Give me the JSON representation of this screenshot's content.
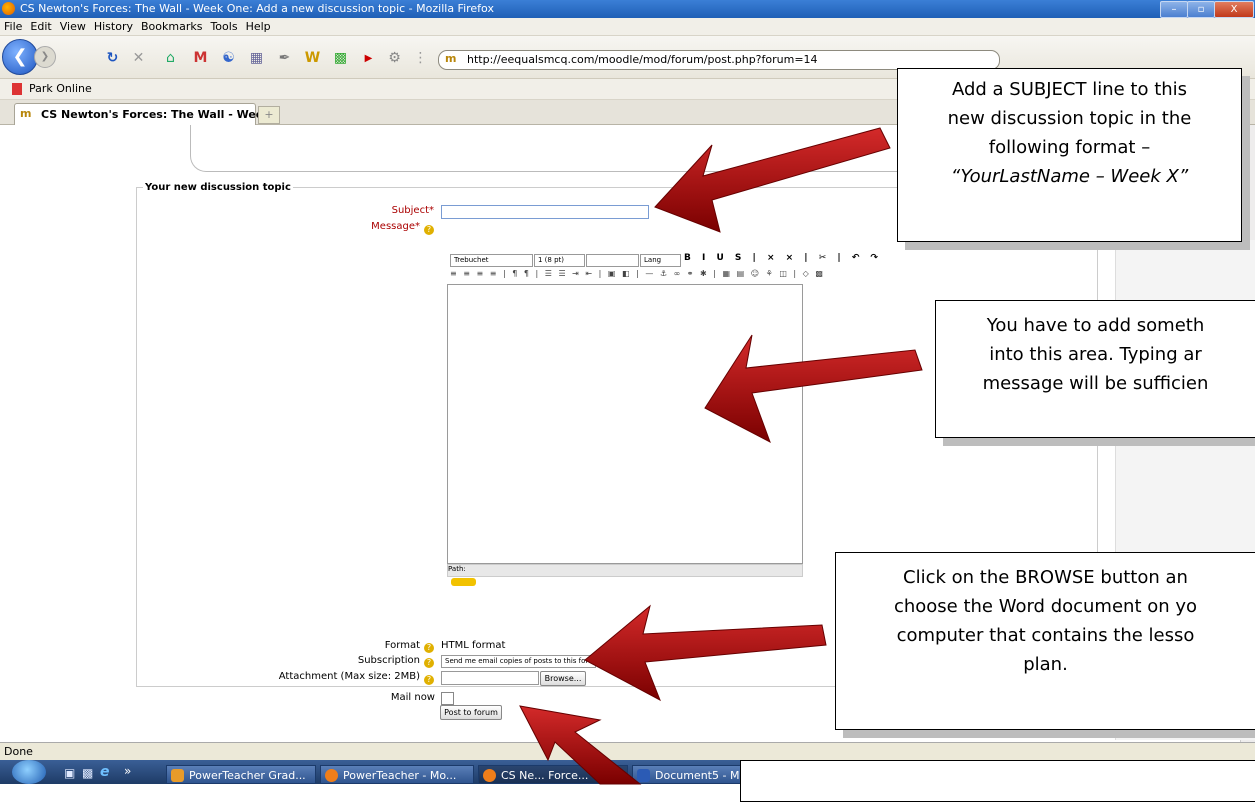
{
  "window": {
    "title": "CS Newton's Forces: The Wall - Week One: Add a new discussion topic - Mozilla Firefox",
    "buttons": [
      "–",
      "▫",
      "X"
    ]
  },
  "menu": [
    "File",
    "Edit",
    "View",
    "History",
    "Bookmarks",
    "Tools",
    "Help"
  ],
  "nav": {
    "url": "http://eequalsmcq.com/moodle/mod/forum/post.php?forum=14",
    "favicon": "m"
  },
  "bookmarks": {
    "item": "Park Online"
  },
  "tabs": [
    {
      "label": "CS Newton's Forces: The Wall - Wee..."
    }
  ],
  "form": {
    "legend": "Your new discussion topic",
    "subject_label": "Subject*",
    "message_label": "Message*",
    "editor": {
      "font": "Trebuchet",
      "size": "1 (8 pt)",
      "lang": "Lang",
      "path": "Path:"
    },
    "format_label": "Format",
    "format_value": "HTML format",
    "subscription_label": "Subscription",
    "subscription_value": "Send me email copies of posts to this forum",
    "attachment_label": "Attachment (Max size: 2MB)",
    "browse_label": "Browse...",
    "mail_now_label": "Mail now",
    "post_button": "Post to forum"
  },
  "status": "Done",
  "taskbar": {
    "items": [
      "PowerTeacher Grad...",
      "PowerTeacher - Mo...",
      "CS Ne... Force...",
      "Document5 - M..."
    ]
  },
  "callouts": {
    "subject": [
      "Add a SUBJECT line to this",
      "new discussion topic in the",
      "following format –",
      "“YourLastName – Week X”"
    ],
    "message": [
      "You have to add someth",
      "into this area.  Typing ar",
      "message will be sufficien"
    ],
    "browse": [
      "Click on the BROWSE button an",
      "choose the Word document on yo",
      "computer that contains the lesso",
      "plan."
    ]
  },
  "colors": {
    "arrow": "#b10d0d",
    "required": "#aa0000",
    "taskbar": "#1e3b66"
  }
}
